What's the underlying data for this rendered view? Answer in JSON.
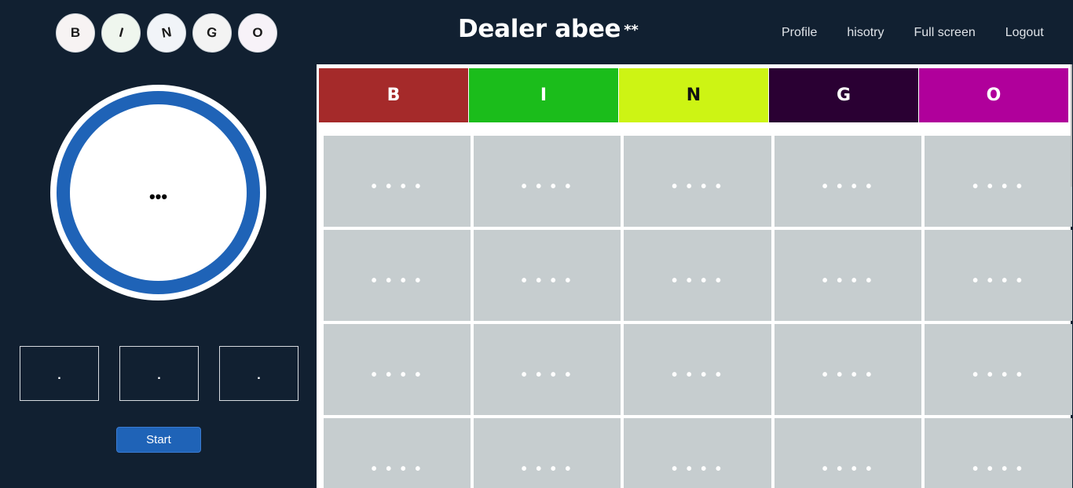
{
  "logo": {
    "letters": [
      "B",
      "I",
      "N",
      "G",
      "O"
    ],
    "colors": [
      "#f7f3f3",
      "#eff6ee",
      "#f1f4f8",
      "#f3f3f3",
      "#f7f2f8"
    ]
  },
  "header": {
    "title": "Dealer abee",
    "title_suffix": "**",
    "nav": [
      "Profile",
      "hisotry",
      "Full screen",
      "Logout"
    ]
  },
  "caller": {
    "current_ball": "•••",
    "recent": [
      ".",
      ".",
      "."
    ],
    "start_label": "Start"
  },
  "board": {
    "columns": [
      {
        "letter": "B",
        "bg": "#a52a2a",
        "fg": "#ffffff"
      },
      {
        "letter": "I",
        "bg": "#1bbd1b",
        "fg": "#ffffff"
      },
      {
        "letter": "N",
        "bg": "#cdf414",
        "fg": "#111111"
      },
      {
        "letter": "G",
        "bg": "#2a0033",
        "fg": "#ffffff"
      },
      {
        "letter": "O",
        "bg": "#b0009b",
        "fg": "#ffffff"
      }
    ],
    "rows": [
      [
        "• • • •",
        "• • • •",
        "• • • •",
        "• • • •",
        "• • • •"
      ],
      [
        "• • • •",
        "• • • •",
        "• • • •",
        "• • • •",
        "• • • •"
      ],
      [
        "• • • •",
        "• • • •",
        "• • • •",
        "• • • •",
        "• • • •"
      ],
      [
        "• • • •",
        "• • • •",
        "• • • •",
        "• • • •",
        "• • • •"
      ]
    ]
  }
}
